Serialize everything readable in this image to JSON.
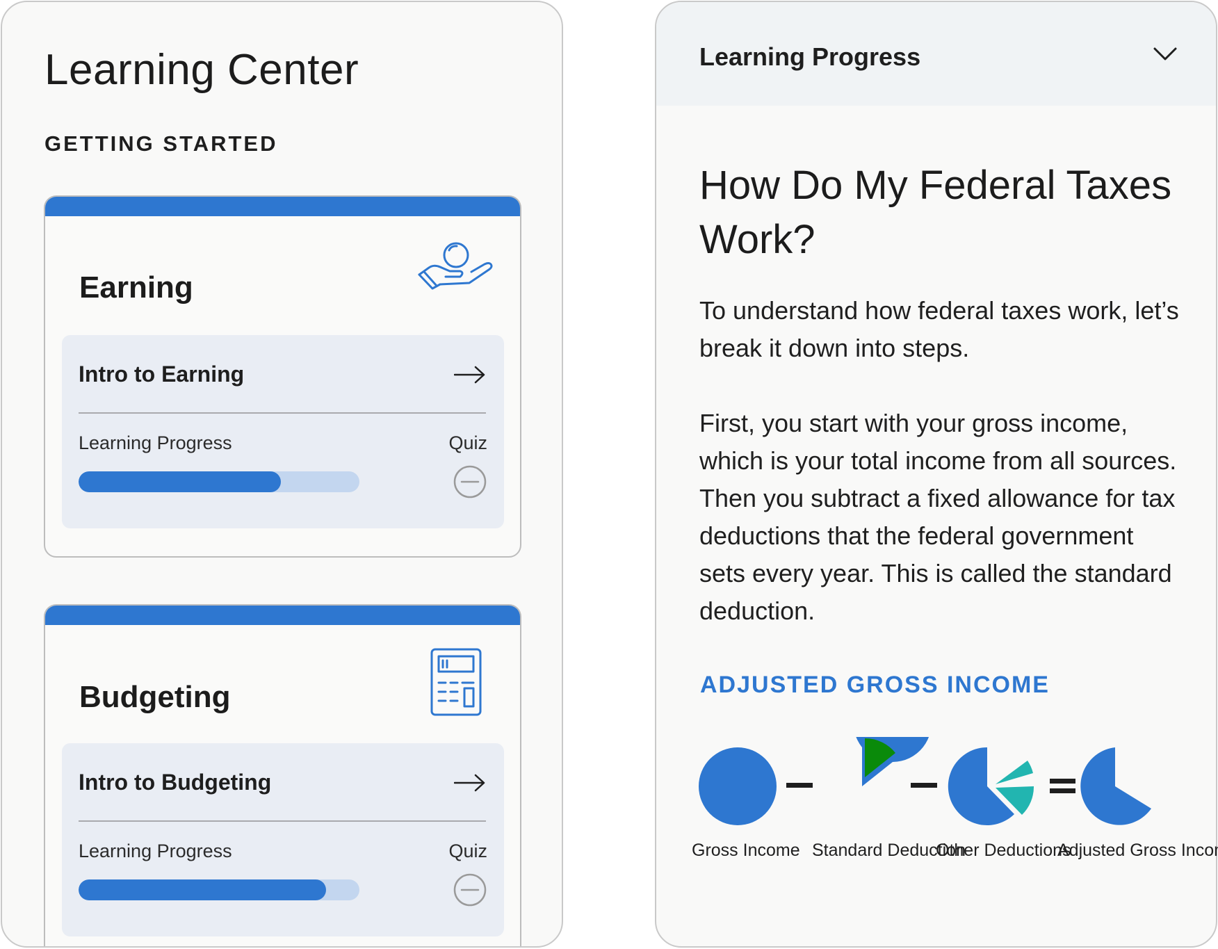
{
  "left_panel": {
    "app_title": "Learning Center",
    "section_label": "GETTING STARTED",
    "cards": [
      {
        "title": "Earning",
        "icon": "hand-coin-icon",
        "lesson": {
          "title": "Intro to Earning",
          "progress_label": "Learning Progress",
          "progress": 0.72,
          "quiz_label": "Quiz",
          "quiz_status_icon": "minus-circle-icon"
        }
      },
      {
        "title": "Budgeting",
        "icon": "calculator-icon",
        "lesson": {
          "title": "Intro to Budgeting",
          "progress_label": "Learning Progress",
          "progress": 0.88,
          "quiz_label": "Quiz",
          "quiz_status_icon": "minus-circle-icon"
        }
      }
    ]
  },
  "right_panel": {
    "accordion_title": "Learning Progress",
    "accordion_icon": "chevron-down-icon",
    "article_title": "How Do My Federal Taxes Work?",
    "paragraphs": [
      "To understand how federal taxes work, let’s break it down into steps.",
      "First, you start with your gross income, which is your total income from all sources. Then you subtract a fixed allowance for tax deductions that the federal government sets every year. This is called the standard deduction."
    ],
    "sub_heading": "ADJUSTED GROSS INCOME",
    "equation": {
      "items": [
        "Gross Income",
        "Standard Deduction",
        "Other Deductions",
        "Adjusted Gross Income"
      ],
      "operators": [
        "–",
        "–",
        "="
      ]
    }
  },
  "colors": {
    "accent_blue": "#2E77D0",
    "progress_track": "#C3D6EF",
    "lesson_box_bg": "#E9EDF4",
    "standard_deduction_green": "#0A8A0A",
    "other_deductions_teal": "#22B5B0",
    "accordion_header_bg": "#F0F3F5"
  }
}
